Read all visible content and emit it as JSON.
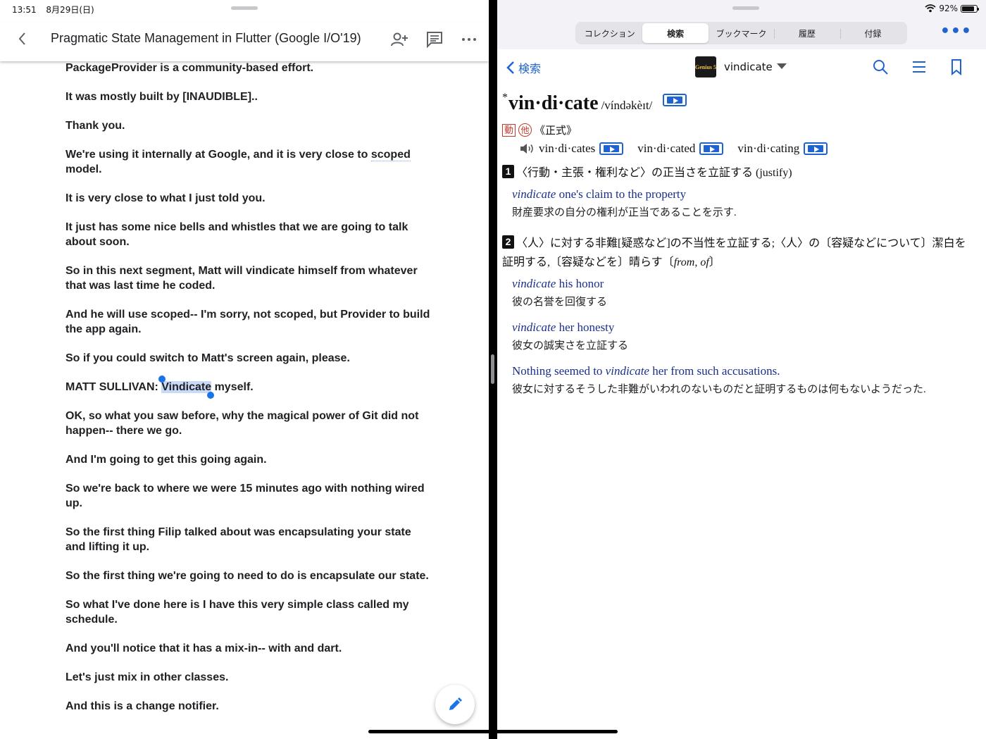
{
  "status": {
    "time": "13:51",
    "date": "8月29日(日)",
    "battery": "92%"
  },
  "doc": {
    "title": "Pragmatic State Management in Flutter (Google I/O'19)",
    "paragraphs": [
      "PackageProvider is a community-based effort.",
      "It was mostly built by [INAUDIBLE]..",
      "Thank you.",
      "We're using it internally at Google, and it is very close to scoped model.",
      "It is very close to what I just told you.",
      "It just has some nice bells and whistles that we are going to talk about soon.",
      "So in this next segment, Matt will vindicate himself from whatever that was last time he coded.",
      "And he will use scoped-- I'm sorry, not scoped, but Provider to build the app again.",
      "So if you could switch to Matt's screen again, please.",
      "MATT SULLIVAN: ",
      "OK, so what you saw before, why the magical power of Git did not happen-- there we go.",
      "And I'm going to get this going again.",
      "So we're back to where we were 15 minutes ago with nothing wired up.",
      "So the first thing Filip talked about was encapsulating your state and lifting it up.",
      "So the first thing we're going to need to do is encapsulate our state.",
      "So what I've done here is I have this very simple class called my schedule.",
      "And you'll notice that it has a mix-in-- with and dart.",
      "Let's just mix in other classes.",
      "And this is a change notifier."
    ],
    "p4_main": "We're using it internally at Google, and it is very close to ",
    "p4_link1": "scoped",
    "p4_tail": " model.",
    "selected_word": "Vindicate",
    "after_selected": " myself."
  },
  "dict": {
    "tabs": [
      "コレクション",
      "検索",
      "ブックマーク",
      "履歴",
      "付録"
    ],
    "active_tab": "検索",
    "back_label": "検索",
    "logo_text": "Genius 5",
    "word": "vindicate",
    "headword_star": "*",
    "headword": "vin·di·cate",
    "pronunciation": "/víndəkèɪt/",
    "pos1": "動",
    "pos2": "他",
    "register": "《正式》",
    "forms": [
      "vin·di·cates",
      "vin·di·cated",
      "vin·di·cating"
    ],
    "sense1": {
      "num": "1",
      "def": "〈行動・主張・権利など〉の正当さを立証する (justify)",
      "ex_en_it": "vindicate",
      "ex_en_rest": " one's claim to the property",
      "ex_ja": "財産要求の自分の権利が正当であることを示す."
    },
    "sense2": {
      "num": "2",
      "def_ja": "〈人〉に対する非難[疑惑など]の不当性を立証する;〈人〉の〔容疑などについて〕潔白を証明する,〔容疑などを〕晴らす〔",
      "def_prep": "from, of",
      "def_close": "〕",
      "ex1_it": "vindicate",
      "ex1_rest": " his honor",
      "ex1_ja": "彼の名誉を回復する",
      "ex2_it": "vindicate",
      "ex2_rest": " her honesty",
      "ex2_ja": "彼女の誠実さを立証する",
      "ex3_pre": "Nothing seemed to ",
      "ex3_it": "vindicate",
      "ex3_rest": " her from such accusations.",
      "ex3_ja": "彼女に対するそうした非難がいわれのないものだと証明するものは何もないようだった."
    }
  },
  "colors": {
    "accent": "#1f63d1",
    "selection": "#c9daf8",
    "pos_red": "#c0392b"
  }
}
